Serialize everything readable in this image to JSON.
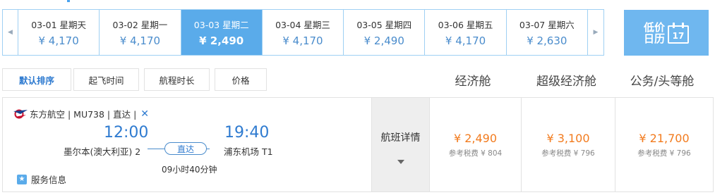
{
  "date_strip": {
    "prev_icon": "chevron-left-icon",
    "next_icon": "chevron-right-icon",
    "dates": [
      {
        "date": "03-01 星期天",
        "price": "¥ 4,170"
      },
      {
        "date": "03-02 星期一",
        "price": "¥ 4,170"
      },
      {
        "date": "03-03 星期二",
        "price": "¥ 2,490"
      },
      {
        "date": "03-04 星期三",
        "price": "¥ 4,170"
      },
      {
        "date": "03-05 星期四",
        "price": "¥ 2,490"
      },
      {
        "date": "03-06 星期五",
        "price": "¥ 4,170"
      },
      {
        "date": "03-07 星期六",
        "price": "¥ 2,630"
      }
    ],
    "active_index": 2
  },
  "low_price_calendar": {
    "label": "低价日历",
    "day": "17",
    "icon": "calendar-icon"
  },
  "sort": {
    "default": "默认排序",
    "departure": "起飞时间",
    "duration": "航程时长",
    "price": "价格"
  },
  "cabins": {
    "economy": "经济舱",
    "premium": "超级经济舱",
    "business": "公务/头等舱"
  },
  "flight": {
    "airline": "东方航空 | MU738 | 直达 |",
    "meal_icon": "fork-knife-icon",
    "depart_time": "12:00",
    "arrive_time": "19:40",
    "depart_airport": "墨尔本(澳大利亚) 2",
    "arrive_airport": "浦东机场 T1",
    "stop_type": "直达",
    "duration": "09小时40分钟",
    "service": "服务信息",
    "detail": "航班详情",
    "prices": [
      {
        "price": "¥ 2,490",
        "tax": "参考税费 ¥ 804"
      },
      {
        "price": "¥ 3,100",
        "tax": "参考税费 ¥ 796"
      },
      {
        "price": "¥ 21,700",
        "tax": "参考税费 ¥ 796"
      }
    ]
  },
  "colors": {
    "accent": "#5aabea",
    "link": "#2f7bd0",
    "price": "#f27b1e"
  }
}
